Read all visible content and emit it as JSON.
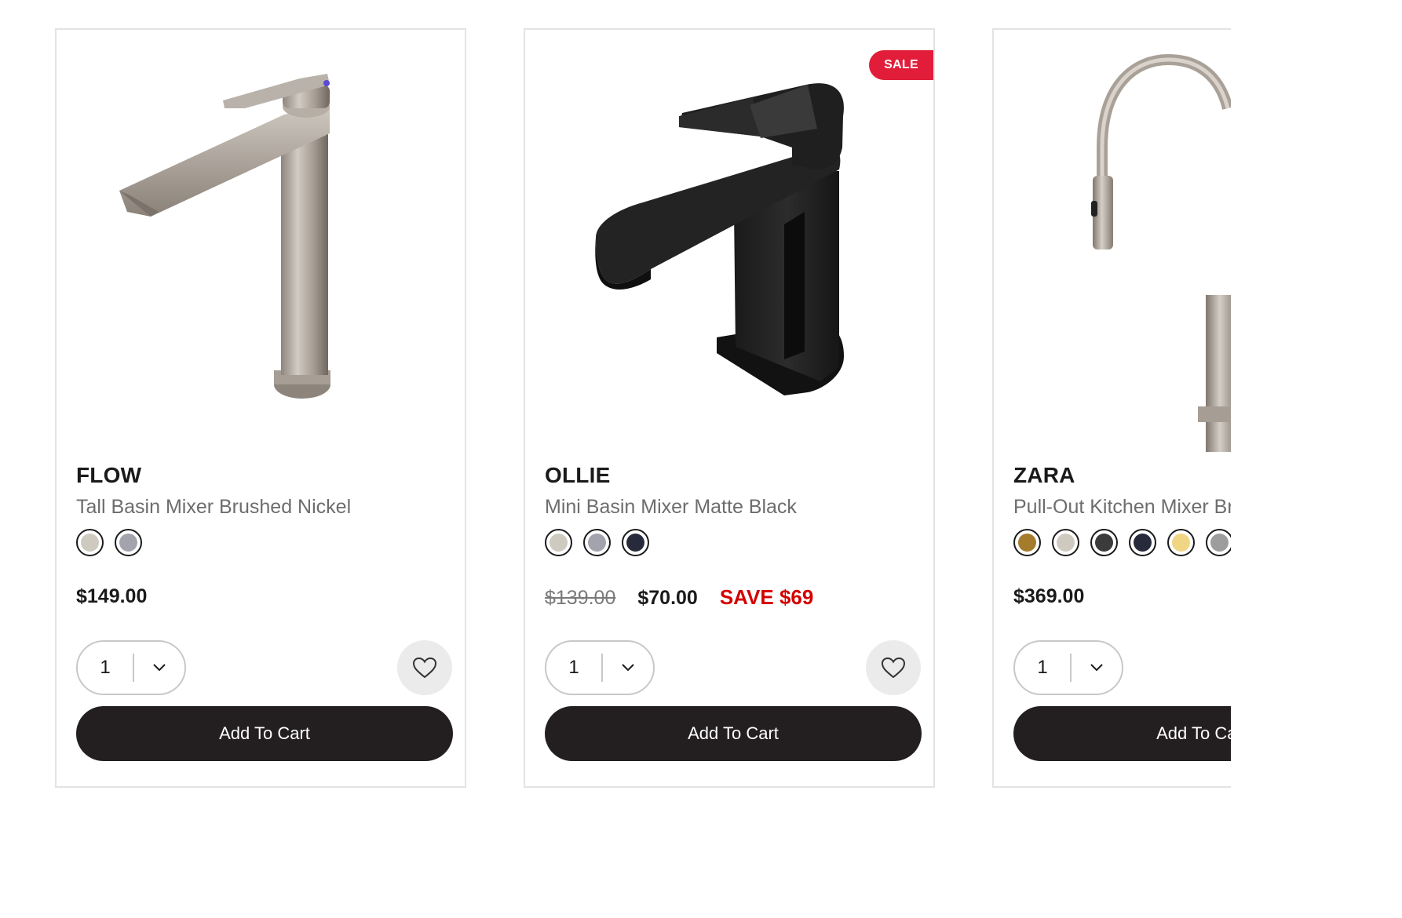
{
  "products": [
    {
      "brand": "FLOW",
      "name": "Tall Basin Mixer Brushed Nickel",
      "swatches": [
        "#cfcac0",
        "#a3a3ae"
      ],
      "price": "$149.00",
      "qty": "1",
      "cart_label": "Add To Cart"
    },
    {
      "brand": "OLLIE",
      "name": "Mini Basin Mixer Matte Black",
      "badge": "SALE",
      "swatches": [
        "#cfcac0",
        "#a3a3ae",
        "#262a3a"
      ],
      "original_price": "$139.00",
      "price": "$70.00",
      "save": "SAVE $69",
      "qty": "1",
      "cart_label": "Add To Cart"
    },
    {
      "brand": "ZARA",
      "name": "Pull-Out Kitchen Mixer Brushed Nickel",
      "swatches": [
        "#a57c2b",
        "#cfcac0",
        "#3b3b3b",
        "#262a3a",
        "#f0d684",
        "#9d9d9d"
      ],
      "price": "$369.00",
      "qty": "1",
      "cart_label": "Add To Cart"
    }
  ],
  "icons": {
    "heart": "heart-icon",
    "chevron": "chevron-down-icon"
  }
}
